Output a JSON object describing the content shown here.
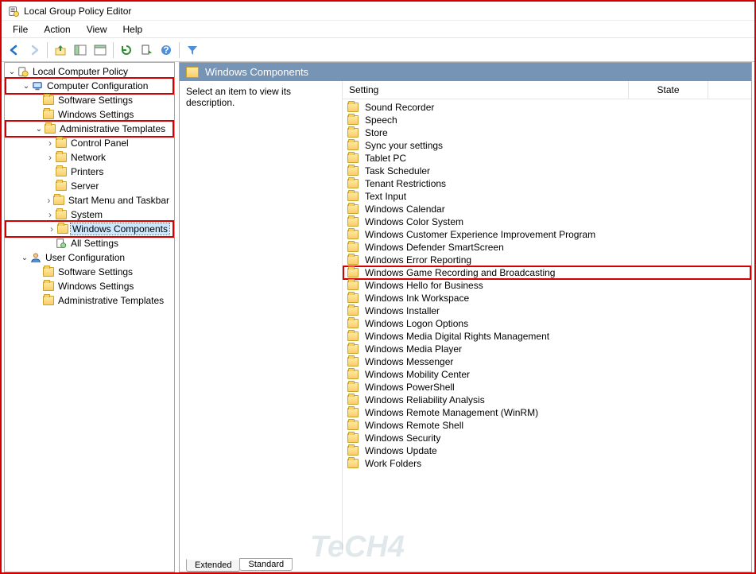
{
  "window": {
    "title": "Local Group Policy Editor"
  },
  "menu": {
    "items": [
      "File",
      "Action",
      "View",
      "Help"
    ]
  },
  "toolbar": {
    "buttons": [
      "back",
      "forward",
      "up",
      "show-hide-tree",
      "show-hide-action",
      "refresh",
      "export",
      "help",
      "filter"
    ]
  },
  "tree": {
    "root": {
      "label": "Local Computer Policy",
      "icon": "policy",
      "expanded": true,
      "children": [
        {
          "label": "Computer Configuration",
          "icon": "computer",
          "expanded": true,
          "highlight": true,
          "children": [
            {
              "label": "Software Settings",
              "icon": "folder"
            },
            {
              "label": "Windows Settings",
              "icon": "folder"
            },
            {
              "label": "Administrative Templates",
              "icon": "folder",
              "expanded": true,
              "highlight": true,
              "children": [
                {
                  "label": "Control Panel",
                  "icon": "folder",
                  "hasChildren": true
                },
                {
                  "label": "Network",
                  "icon": "folder",
                  "hasChildren": true
                },
                {
                  "label": "Printers",
                  "icon": "folder"
                },
                {
                  "label": "Server",
                  "icon": "folder"
                },
                {
                  "label": "Start Menu and Taskbar",
                  "icon": "folder",
                  "hasChildren": true
                },
                {
                  "label": "System",
                  "icon": "folder",
                  "hasChildren": true
                },
                {
                  "label": "Windows Components",
                  "icon": "folder",
                  "hasChildren": true,
                  "highlight": true,
                  "selected": true
                },
                {
                  "label": "All Settings",
                  "icon": "settings"
                }
              ]
            }
          ]
        },
        {
          "label": "User Configuration",
          "icon": "user",
          "expanded": true,
          "children": [
            {
              "label": "Software Settings",
              "icon": "folder"
            },
            {
              "label": "Windows Settings",
              "icon": "folder"
            },
            {
              "label": "Administrative Templates",
              "icon": "folder"
            }
          ]
        }
      ]
    }
  },
  "content": {
    "title": "Windows Components",
    "description": "Select an item to view its description.",
    "columns": {
      "setting": "Setting",
      "state": "State"
    },
    "items": [
      {
        "label": "Sound Recorder"
      },
      {
        "label": "Speech"
      },
      {
        "label": "Store"
      },
      {
        "label": "Sync your settings"
      },
      {
        "label": "Tablet PC"
      },
      {
        "label": "Task Scheduler"
      },
      {
        "label": "Tenant Restrictions"
      },
      {
        "label": "Text Input"
      },
      {
        "label": "Windows Calendar"
      },
      {
        "label": "Windows Color System"
      },
      {
        "label": "Windows Customer Experience Improvement Program"
      },
      {
        "label": "Windows Defender SmartScreen"
      },
      {
        "label": "Windows Error Reporting"
      },
      {
        "label": "Windows Game Recording and Broadcasting",
        "highlight": true
      },
      {
        "label": "Windows Hello for Business"
      },
      {
        "label": "Windows Ink Workspace"
      },
      {
        "label": "Windows Installer"
      },
      {
        "label": "Windows Logon Options"
      },
      {
        "label": "Windows Media Digital Rights Management"
      },
      {
        "label": "Windows Media Player"
      },
      {
        "label": "Windows Messenger"
      },
      {
        "label": "Windows Mobility Center"
      },
      {
        "label": "Windows PowerShell"
      },
      {
        "label": "Windows Reliability Analysis"
      },
      {
        "label": "Windows Remote Management (WinRM)"
      },
      {
        "label": "Windows Remote Shell"
      },
      {
        "label": "Windows Security"
      },
      {
        "label": "Windows Update"
      },
      {
        "label": "Work Folders"
      }
    ],
    "tabs": {
      "extended": "Extended",
      "standard": "Standard"
    }
  }
}
